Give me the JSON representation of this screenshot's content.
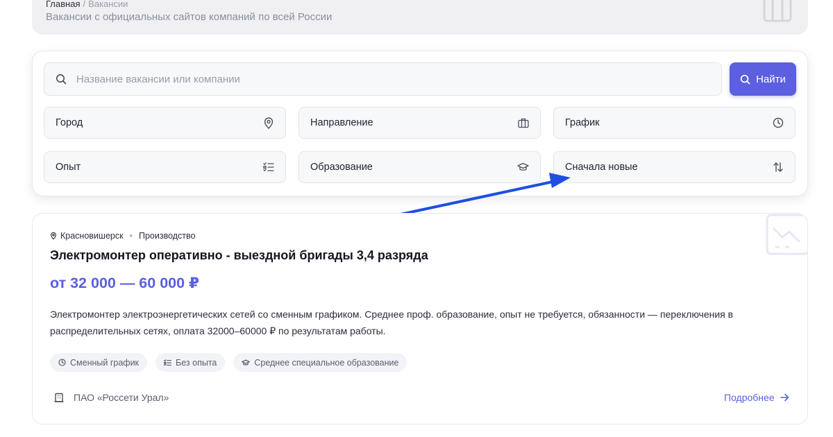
{
  "header": {
    "breadcrumb": {
      "home": "Главная",
      "separator": "/",
      "current": "Вакансии"
    },
    "subtitle": "Вакансии с официальных сайтов компаний по всей России",
    "icon": "briefcase-icon"
  },
  "search": {
    "placeholder": "Название вакансии или компании",
    "button_label": "Найти",
    "accent_color": "#5b5fe0"
  },
  "filters": [
    {
      "label": "Город",
      "icon": "map-pin-icon"
    },
    {
      "label": "Направление",
      "icon": "briefcase-icon"
    },
    {
      "label": "График",
      "icon": "clock-icon"
    },
    {
      "label": "Опыт",
      "icon": "checklist-icon"
    },
    {
      "label": "Образование",
      "icon": "graduation-cap-icon"
    },
    {
      "label": "Сначала новые",
      "icon": "sort-arrows-icon"
    }
  ],
  "annotation": {
    "type": "arrow",
    "color": "#1f4fe0"
  },
  "vacancy": {
    "city": "Красновишерск",
    "category": "Производство",
    "title": "Электромонтер оперативно - выездной бригады 3,4 разряда",
    "salary": "от 32 000 — 60 000 ₽",
    "description": "Электромонтер электроэнергетических сетей со сменным графиком. Среднее проф. образование, опыт не требуется, обязанности — переключения в распределительных сетях, оплата 32000–60000 ₽ по результатам работы.",
    "tags": [
      {
        "label": "Сменный график",
        "icon": "clock-icon"
      },
      {
        "label": "Без опыта",
        "icon": "checklist-icon"
      },
      {
        "label": "Среднее специальное образование",
        "icon": "graduation-cap-icon"
      }
    ],
    "company": "ПАО «Россети Урал»",
    "company_icon": "building-icon",
    "more_label": "Подробнее"
  }
}
